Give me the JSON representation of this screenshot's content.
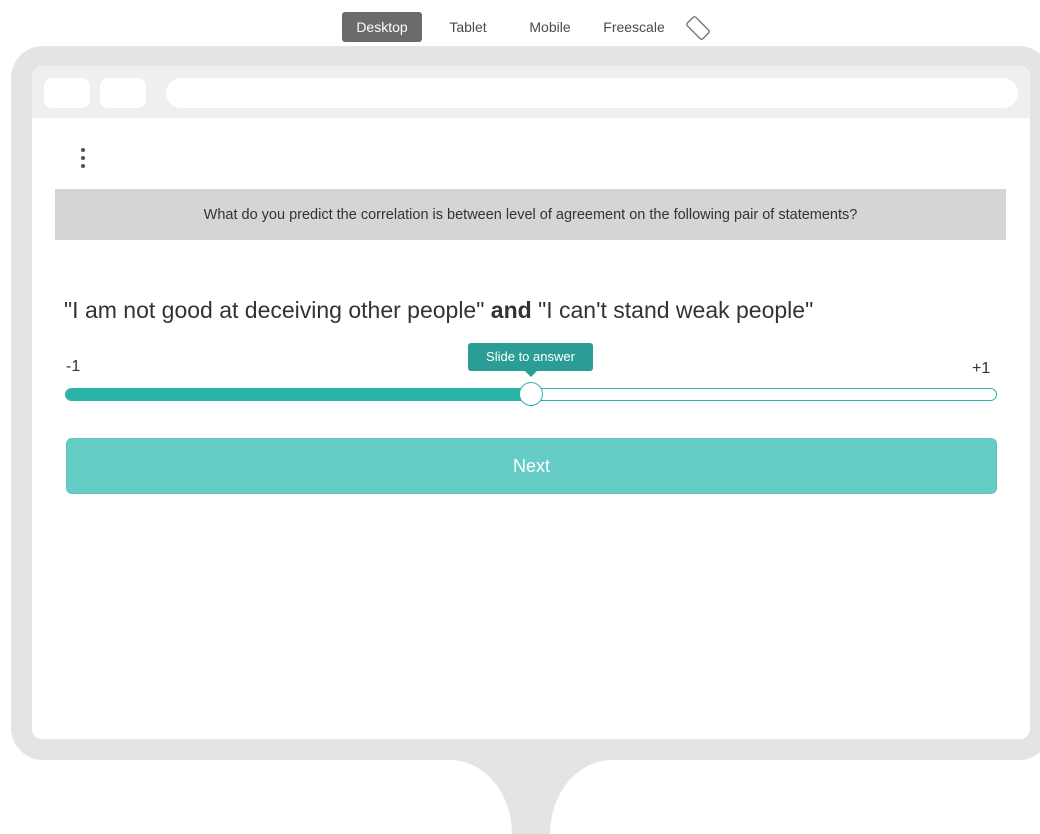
{
  "device_toggle": {
    "options": [
      "Desktop",
      "Tablet",
      "Mobile",
      "Freescale"
    ],
    "active": "Desktop",
    "rotate_icon": "rotate-device-icon"
  },
  "survey": {
    "menu_icon": "kebab-menu-icon",
    "prompt": "What do you predict the correlation is between level of agreement on the following pair of statements?",
    "statement_a": "\"I am not good at deceiving other people\"",
    "conjunction": "and",
    "statement_b": "\"I can't stand weak people\"",
    "scale_min_label": "-1",
    "scale_max_label": "+1",
    "slider_tooltip": "Slide to answer",
    "slider_value_fraction": 0.5,
    "next_label": "Next"
  },
  "colors": {
    "accent": "#2ab3a8",
    "button": "#66cdc6",
    "tooltip": "#2a9d95"
  }
}
